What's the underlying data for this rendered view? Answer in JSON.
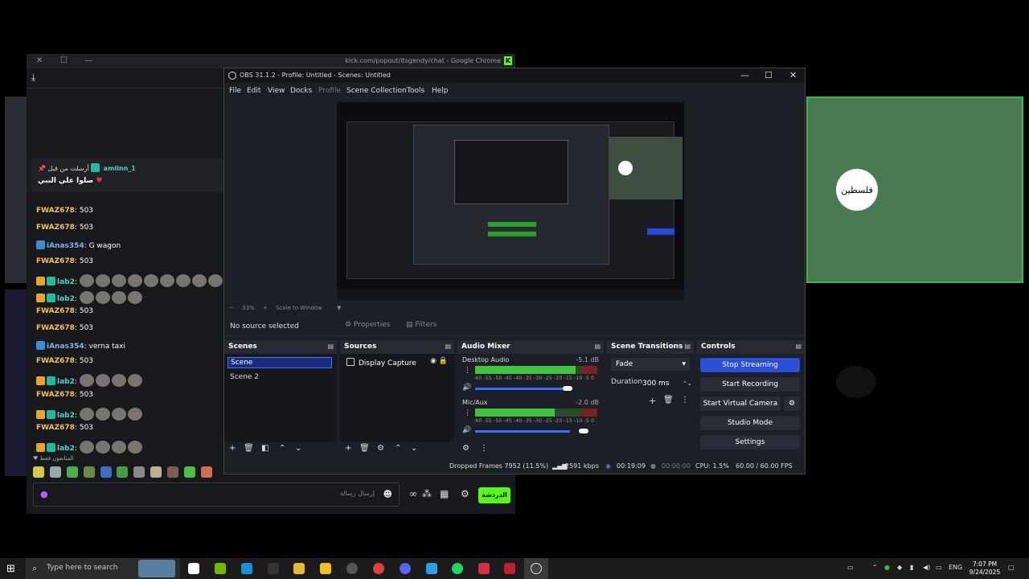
{
  "right_tile": {
    "circle_text": "فلسطين"
  },
  "chrome": {
    "title": "kick.com/popout/itsgendy/chat - Google Chrome"
  },
  "chat": {
    "pinned_by": "أرسلت من قبل",
    "pinned_user": "amilnn_1",
    "pinned_text": "صلوا علي النبي",
    "messages": [
      {
        "user": "FWAZ678",
        "text": ": 503",
        "style": "gold"
      },
      {
        "user": "FWAZ678",
        "text": ": 503",
        "style": "gold"
      },
      {
        "user": "iAnas354",
        "text": ": G wagon",
        "style": "blue"
      },
      {
        "user": "FWAZ678",
        "text": ": 503",
        "style": "gold"
      },
      {
        "user": "lab2",
        "text": ":",
        "style": "teal"
      },
      {
        "user": "lab2",
        "text": ":",
        "style": "teal"
      },
      {
        "user": "FWAZ678",
        "text": ": 503",
        "style": "gold"
      },
      {
        "user": "FWAZ678",
        "text": ": 503",
        "style": "gold"
      },
      {
        "user": "iAnas354",
        "text": ": verna taxi",
        "style": "blue"
      },
      {
        "user": "FWAZ678",
        "text": ": 503",
        "style": "gold"
      },
      {
        "user": "lab2",
        "text": ":",
        "style": "teal"
      },
      {
        "user": "FWAZ678",
        "text": ": 503",
        "style": "gold"
      },
      {
        "user": "lab2",
        "text": ":",
        "style": "teal"
      },
      {
        "user": "FWAZ678",
        "text": ": 503",
        "style": "gold"
      },
      {
        "user": "lab2",
        "text": ":",
        "style": "teal"
      }
    ],
    "supporters_label": "♥ المتابعون فقط",
    "input_placeholder": "إرسال رسالة",
    "send_label": "الدردشة"
  },
  "obs": {
    "title": "OBS 31.1.2 - Profile: Untitled - Scenes: Untitled",
    "menu": [
      "File",
      "Edit",
      "View",
      "Docks",
      "Profile",
      "Scene Collection",
      "Tools",
      "Help"
    ],
    "zoom": "33%",
    "scale_label": "Scale to Window",
    "no_source": "No source selected",
    "properties_label": "Properties",
    "filters_label": "Filters",
    "docks": {
      "scenes": "Scenes",
      "sources": "Sources",
      "audio_mixer": "Audio Mixer",
      "scene_transitions": "Scene Transitions",
      "controls": "Controls"
    },
    "scenes": [
      "Scene",
      "Scene 2"
    ],
    "sources": [
      "Display Capture"
    ],
    "audio": [
      {
        "name": "Desktop Audio",
        "db": "-5.1 dB",
        "level": 0.82,
        "volume": 0.78
      },
      {
        "name": "Mic/Aux",
        "db": "-2.0 dB",
        "level": 0.65,
        "volume": 0.92
      }
    ],
    "meter_scale": "-60 -55 -50 -45 -40 -35 -30 -25 -20 -15 -10 -5 0",
    "transition": "Fade",
    "duration_label": "Duration",
    "duration_value": "300 ms",
    "controls": [
      "Stop Streaming",
      "Start Recording",
      "Start Virtual Camera",
      "Studio Mode",
      "Settings"
    ],
    "status": {
      "dropped": "Dropped Frames 7952 (11.5%)",
      "bitrate": "2591 kbps",
      "stream_time": "00:19:09",
      "rec_time": "00:00:00",
      "cpu": "CPU: 1.5%",
      "fps": "60.00 / 60.00 FPS"
    }
  },
  "taskbar": {
    "search_placeholder": "Type here to search",
    "lang": "ENG",
    "time": "7:07 PM",
    "date": "9/24/2025"
  }
}
